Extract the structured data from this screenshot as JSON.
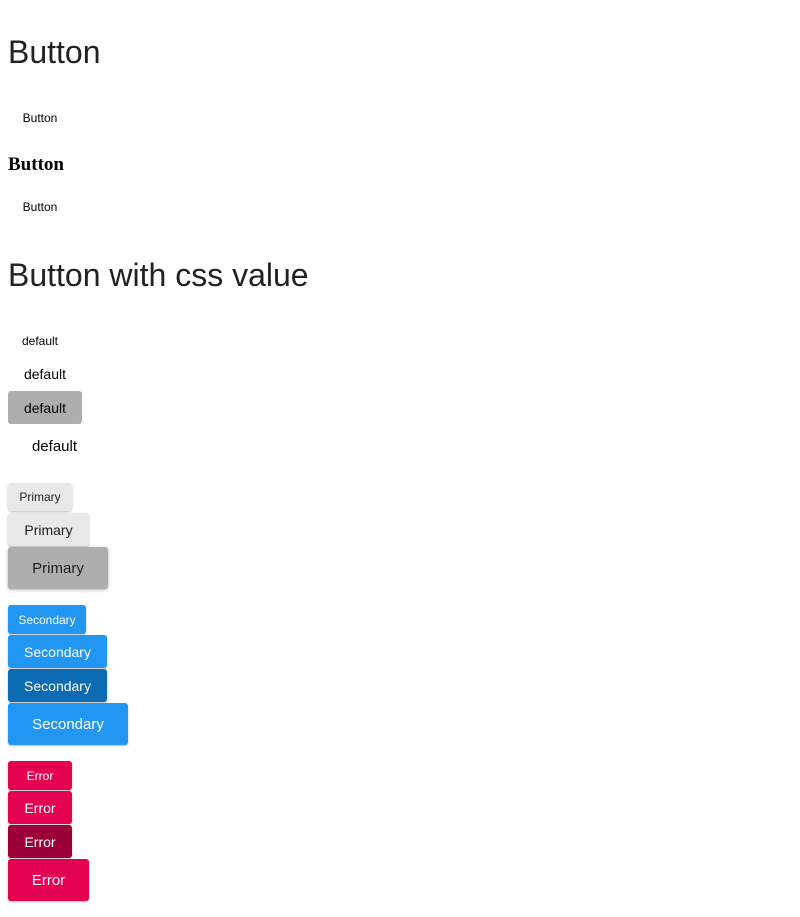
{
  "section1": {
    "title": "Button",
    "button_1": "Button",
    "subtitle": "Button",
    "button_2": "Button"
  },
  "section2": {
    "title": "Button with css value",
    "default_buttons": [
      "default",
      "default",
      "default",
      "default"
    ],
    "primary_buttons": [
      "Primary",
      "Primary",
      "Primary"
    ],
    "secondary_buttons": [
      "Secondary",
      "Secondary",
      "Secondary",
      "Secondary"
    ],
    "error_buttons": [
      "Error",
      "Error",
      "Error",
      "Error"
    ]
  },
  "colors": {
    "primary_light": "#e8e8e8",
    "gray": "#aeaeae",
    "secondary": "#2196f3",
    "secondary_dark": "#0d6bb3",
    "error": "#e2024f",
    "error_dark": "#9c0038"
  }
}
